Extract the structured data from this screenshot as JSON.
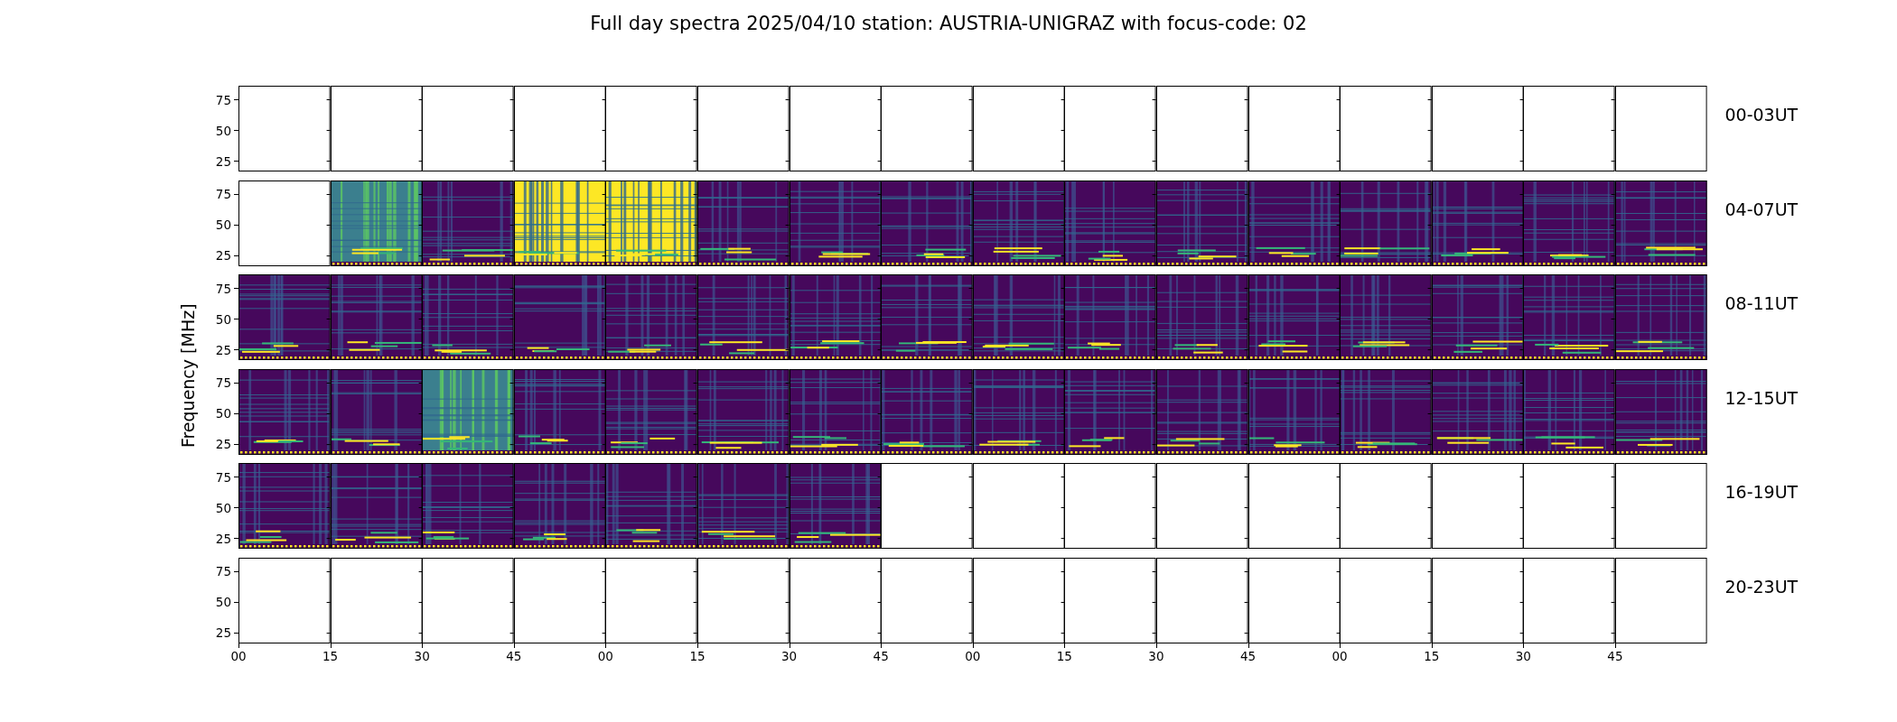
{
  "title": "Full day spectra 2025/04/10 station: AUSTRIA-UNIGRAZ with focus-code: 02",
  "ylabel": "Frequency [MHz]",
  "rows": [
    {
      "label": "00-03UT",
      "yticks": [
        "75",
        "50",
        "25"
      ],
      "panels": [
        {
          "kind": "empty"
        },
        {
          "kind": "empty"
        },
        {
          "kind": "empty"
        },
        {
          "kind": "empty"
        },
        {
          "kind": "empty"
        },
        {
          "kind": "empty"
        },
        {
          "kind": "empty"
        },
        {
          "kind": "empty"
        },
        {
          "kind": "empty"
        },
        {
          "kind": "empty"
        },
        {
          "kind": "empty"
        },
        {
          "kind": "empty"
        },
        {
          "kind": "empty"
        },
        {
          "kind": "empty"
        },
        {
          "kind": "empty"
        },
        {
          "kind": "empty"
        }
      ]
    },
    {
      "label": "04-07UT",
      "yticks": [
        "75",
        "50",
        "25"
      ],
      "panels": [
        {
          "kind": "empty"
        },
        {
          "kind": "active"
        },
        {
          "kind": "quiet"
        },
        {
          "kind": "saturated"
        },
        {
          "kind": "saturated"
        },
        {
          "kind": "quiet"
        },
        {
          "kind": "quiet"
        },
        {
          "kind": "quiet"
        },
        {
          "kind": "quiet"
        },
        {
          "kind": "quiet"
        },
        {
          "kind": "quiet"
        },
        {
          "kind": "quiet"
        },
        {
          "kind": "quiet"
        },
        {
          "kind": "quiet"
        },
        {
          "kind": "quiet"
        },
        {
          "kind": "quiet"
        }
      ]
    },
    {
      "label": "08-11UT",
      "yticks": [
        "75",
        "50",
        "25"
      ],
      "panels": [
        {
          "kind": "quiet"
        },
        {
          "kind": "quiet"
        },
        {
          "kind": "quiet"
        },
        {
          "kind": "quiet"
        },
        {
          "kind": "quiet"
        },
        {
          "kind": "quiet"
        },
        {
          "kind": "quiet"
        },
        {
          "kind": "quiet"
        },
        {
          "kind": "quiet"
        },
        {
          "kind": "quiet"
        },
        {
          "kind": "quiet"
        },
        {
          "kind": "quiet"
        },
        {
          "kind": "quiet"
        },
        {
          "kind": "quiet"
        },
        {
          "kind": "quiet"
        },
        {
          "kind": "quiet"
        }
      ]
    },
    {
      "label": "12-15UT",
      "yticks": [
        "75",
        "50",
        "25"
      ],
      "panels": [
        {
          "kind": "quiet"
        },
        {
          "kind": "quiet"
        },
        {
          "kind": "active"
        },
        {
          "kind": "quiet"
        },
        {
          "kind": "quiet"
        },
        {
          "kind": "quiet"
        },
        {
          "kind": "quiet"
        },
        {
          "kind": "quiet"
        },
        {
          "kind": "quiet"
        },
        {
          "kind": "quiet"
        },
        {
          "kind": "quiet"
        },
        {
          "kind": "quiet"
        },
        {
          "kind": "quiet"
        },
        {
          "kind": "quiet"
        },
        {
          "kind": "quiet"
        },
        {
          "kind": "quiet"
        }
      ]
    },
    {
      "label": "16-19UT",
      "yticks": [
        "75",
        "50",
        "25"
      ],
      "panels": [
        {
          "kind": "quiet"
        },
        {
          "kind": "quiet"
        },
        {
          "kind": "quiet"
        },
        {
          "kind": "quiet"
        },
        {
          "kind": "quiet"
        },
        {
          "kind": "quiet"
        },
        {
          "kind": "quiet"
        },
        {
          "kind": "empty"
        },
        {
          "kind": "empty"
        },
        {
          "kind": "empty"
        },
        {
          "kind": "empty"
        },
        {
          "kind": "empty"
        },
        {
          "kind": "empty"
        },
        {
          "kind": "empty"
        },
        {
          "kind": "empty"
        },
        {
          "kind": "empty"
        }
      ]
    },
    {
      "label": "20-23UT",
      "yticks": [
        "75",
        "50",
        "25"
      ],
      "panels": [
        {
          "kind": "empty"
        },
        {
          "kind": "empty"
        },
        {
          "kind": "empty"
        },
        {
          "kind": "empty"
        },
        {
          "kind": "empty"
        },
        {
          "kind": "empty"
        },
        {
          "kind": "empty"
        },
        {
          "kind": "empty"
        },
        {
          "kind": "empty"
        },
        {
          "kind": "empty"
        },
        {
          "kind": "empty"
        },
        {
          "kind": "empty"
        },
        {
          "kind": "empty"
        },
        {
          "kind": "empty"
        },
        {
          "kind": "empty"
        },
        {
          "kind": "empty"
        }
      ]
    }
  ],
  "xticks": [
    "00",
    "15",
    "30",
    "45",
    "00",
    "15",
    "30",
    "45",
    "00",
    "15",
    "30",
    "45",
    "00",
    "15",
    "30",
    "45"
  ]
}
